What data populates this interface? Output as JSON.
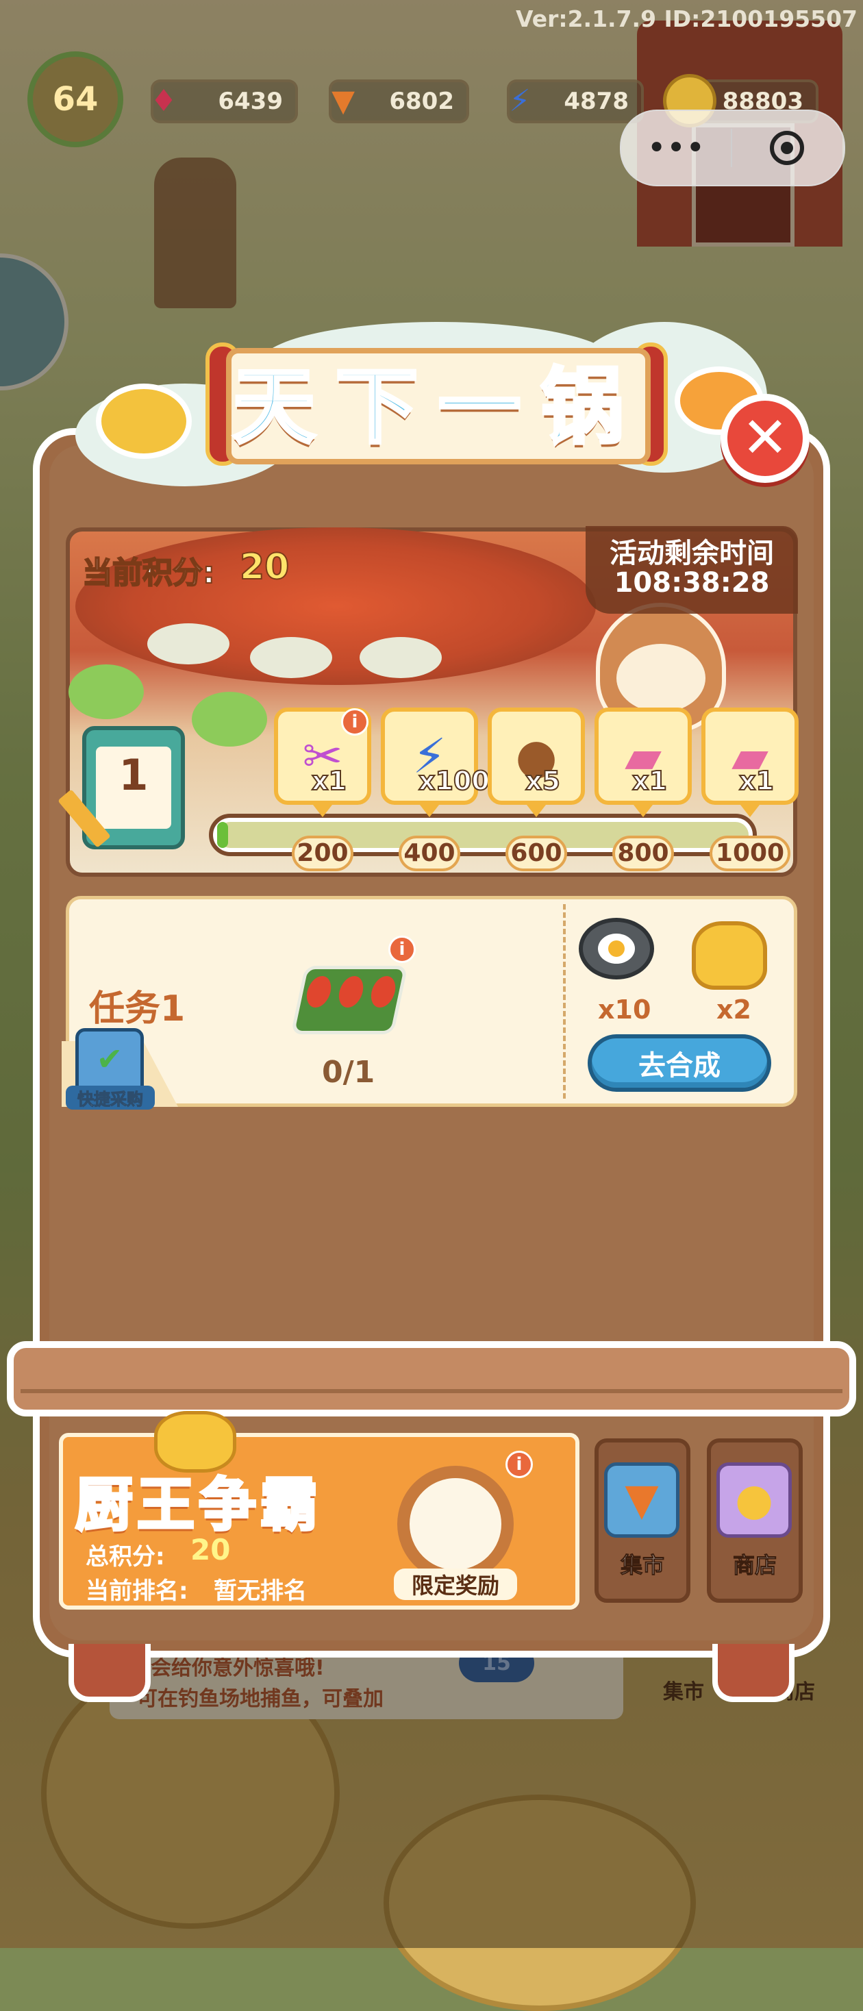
{
  "hud": {
    "version": "Ver:2.1.7.9 ID:2100195507",
    "level": "64",
    "gems": "6439",
    "carrots": "6802",
    "energy": "4878",
    "coins": "88803"
  },
  "popup": {
    "title": "天下一锅",
    "current_score_label": "当前积分:",
    "current_score": "20",
    "timer_label": "活动剩余时间",
    "timer_value": "108:38:28",
    "stage": "1",
    "progress": 0,
    "rewards": [
      {
        "icon": "scissors-icon",
        "count": "x1",
        "milestone": "200"
      },
      {
        "icon": "energy-bolt-icon",
        "count": "x100",
        "milestone": "400"
      },
      {
        "icon": "acorn-icon",
        "count": "x5",
        "milestone": "600"
      },
      {
        "icon": "rainbow-ticket-icon",
        "count": "x1",
        "milestone": "800"
      },
      {
        "icon": "rainbow-ticket-icon",
        "count": "x1",
        "milestone": "1000"
      }
    ],
    "task": {
      "title": "任务1",
      "progress": "0/1",
      "shortcut_label": "快捷采购",
      "reward_1_count": "x10",
      "reward_2_count": "x2",
      "action_label": "去合成"
    }
  },
  "event": {
    "title": "厨王争霸",
    "total_score_label": "总积分:",
    "total_score": "20",
    "rank_label": "当前排名:",
    "rank_value": "暂无排名",
    "reward_label": "限定奖励"
  },
  "shops": {
    "market_label": "集市",
    "store_label": "商店"
  },
  "background": {
    "notice_line1": "会给你意外惊喜哦!",
    "notice_line2": "可在钓鱼场地捕鱼，可叠加",
    "badge_num": "15",
    "market_label": "集市",
    "store_label": "商店"
  },
  "colors": {
    "accent_orange": "#f49c3c",
    "button_blue": "#46a7dc",
    "close_red": "#e8483b",
    "cabinet_brown": "#9e6a45"
  }
}
